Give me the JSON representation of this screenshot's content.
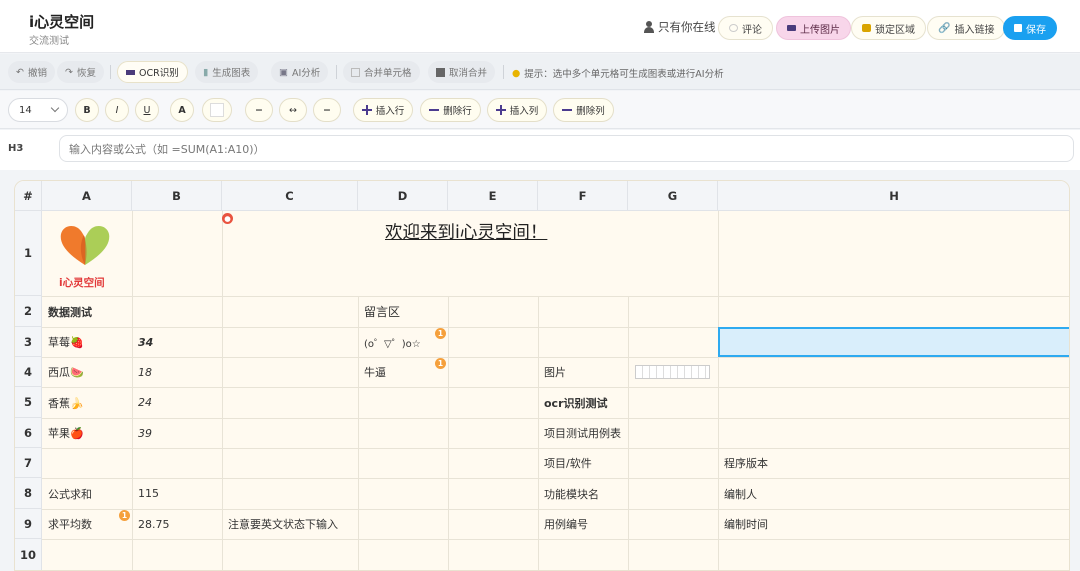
{
  "app": {
    "title": "i心灵空间",
    "subtitle": "交流测试"
  },
  "header": {
    "online_text": "只有你在线",
    "buttons": {
      "comment": "评论",
      "upload": "上传图片",
      "lock": "锁定区域",
      "link": "插入链接",
      "save": "保存"
    }
  },
  "toolbar": {
    "undo": "撤销",
    "redo": "恢复",
    "ocr": "OCR识别",
    "chart": "生成图表",
    "ai": "AI分析",
    "merge": "合并单元格",
    "unmerge": "取消合并",
    "hint": "提示：选中多个单元格可生成图表或进行AI分析"
  },
  "format": {
    "font_size": "14",
    "bold": "B",
    "italic": "I",
    "underline": "U",
    "font_color": "A",
    "border_minus": "−",
    "border_both": "↔",
    "border_minus2": "−",
    "insert_row": "插入行",
    "delete_row": "删除行",
    "insert_col": "插入列",
    "delete_col": "删除列"
  },
  "formula_bar": {
    "cell_ref": "H3",
    "placeholder": "输入内容或公式（如 =SUM(A1:A10)）"
  },
  "sheet": {
    "corner": "#",
    "columns": [
      "A",
      "B",
      "C",
      "D",
      "E",
      "F",
      "G",
      "H"
    ],
    "rows": [
      "1",
      "2",
      "3",
      "4",
      "5",
      "6",
      "7",
      "8",
      "9",
      "10"
    ],
    "logo_text": "i心灵空间",
    "banner": "欢迎来到i心灵空间！",
    "cells": {
      "A2": "数据测试",
      "D2": "留言区",
      "A3": "草莓🍓",
      "B3": "34",
      "D3": "(o゜▽゜)o☆",
      "A4": "西瓜🍉",
      "B4": "18",
      "D4": "牛逼",
      "F4": "图片",
      "A5": "香蕉🍌",
      "B5": "24",
      "F5": "ocr识别测试",
      "A6": "苹果🍎",
      "B6": "39",
      "F6": "项目测试用例表",
      "F7": "项目/软件",
      "H7": "程序版本",
      "A8": "公式求和",
      "B8": "115",
      "F8": "功能模块名",
      "H8": "编制人",
      "A9": "求平均数",
      "B9": "28.75",
      "C9": "注意要英文状态下输入",
      "F9": "用例编号",
      "H9": "编制时间"
    },
    "badges": {
      "D3": "1",
      "D4": "1",
      "A9": "1"
    }
  },
  "colors": {
    "accent": "#1aa0f0",
    "selection": "#2eaaf0",
    "upload_pink": "#f8d6ea"
  }
}
